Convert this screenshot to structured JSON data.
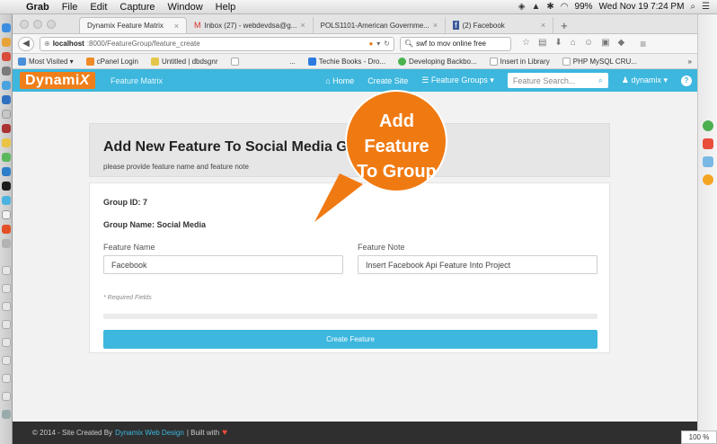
{
  "menubar": {
    "apple_icon": "apple-icon",
    "items": [
      "Grab",
      "File",
      "Edit",
      "Capture",
      "Window",
      "Help"
    ],
    "status": {
      "battery": "99%",
      "datetime": "Wed Nov 19  7:24 PM"
    }
  },
  "browser": {
    "tabs": [
      {
        "label": "Dynamix Feature Matrix",
        "active": true
      },
      {
        "label": "Inbox (27) - webdevdsa@g...",
        "icon": "gmail-icon"
      },
      {
        "label": "POLS1101-American Governme...",
        "icon": "page-icon"
      },
      {
        "label": "(2) Facebook",
        "icon": "facebook-icon"
      }
    ],
    "new_tab": "+",
    "url": {
      "host": "localhost",
      "path": ":8000/FeatureGroup/feature_create"
    },
    "search_value": "swf to mov online free",
    "bookmarks": [
      {
        "label": "Most Visited ▾"
      },
      {
        "label": "cPanel Login"
      },
      {
        "label": "Untitled | dbdsgnr"
      },
      {
        "label": "..."
      },
      {
        "label": "Techie Books - Dro..."
      },
      {
        "label": "Developing Backbo..."
      },
      {
        "label": "Insert in Library"
      },
      {
        "label": "PHP MySQL CRU..."
      }
    ],
    "bookmarks_overflow": "»",
    "zoom": "100 %"
  },
  "site": {
    "brand_prefix": "Dynami",
    "brand_suffix": "X",
    "subtitle": "Feature Matrix",
    "nav": {
      "home": "Home",
      "create_site": "Create Site",
      "feature_groups": "Feature Groups ▾",
      "search_placeholder": "Feature Search...",
      "user": "dynamix ▾",
      "help": "?"
    },
    "header": {
      "title": "Add New Feature To Social Media Group",
      "subtitle": "please provide feature name and feature note"
    },
    "form": {
      "group_id": "Group ID: 7",
      "group_name": "Group Name: Social Media",
      "feature_name_label": "Feature Name",
      "feature_name_value": "Facebook",
      "feature_note_label": "Feature Note",
      "feature_note_value": "Insert  Facebook Api Feature Into Project",
      "required": "* Required Fields",
      "submit": "Create Feature"
    },
    "footer": {
      "prefix": "© 2014 - Site Created By",
      "link": "Dynamix Web Design",
      "suffix": "| Built with"
    }
  },
  "callout": {
    "lines": [
      "Add",
      "Feature",
      "To Group"
    ],
    "color": "#f07a12"
  },
  "colors": {
    "accent": "#3db7de",
    "brand": "#ef7f1a"
  }
}
